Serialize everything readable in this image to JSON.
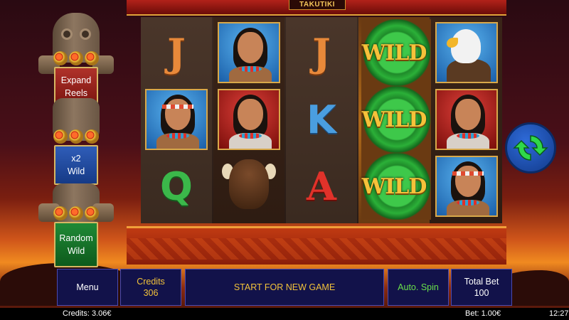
{
  "game": {
    "logo": "TAKUTIKI"
  },
  "features": {
    "expand": [
      "Expand",
      "Reels"
    ],
    "wild": [
      "x2",
      "Wild"
    ],
    "random": [
      "Random",
      "Wild"
    ]
  },
  "reels": {
    "r0": [
      "J",
      "portrait-man",
      "Q"
    ],
    "r1": [
      "portrait-man",
      "portrait-woman",
      "buffalo"
    ],
    "r2": [
      "J",
      "K",
      "A"
    ],
    "r3": [
      "WILD",
      "WILD",
      "WILD"
    ],
    "r4": [
      "eagle",
      "portrait-woman",
      "portrait-man"
    ],
    "wild_text": "WILD"
  },
  "controls": {
    "menu": "Menu",
    "credits_label": "Credits",
    "credits_value": "306",
    "start": "START FOR NEW GAME",
    "auto_spin": "Auto. Spin",
    "total_bet_label": "Total Bet",
    "total_bet_value": "100"
  },
  "status": {
    "credits": "Credits: 3.06€",
    "bet": "Bet: 1.00€",
    "time": "12:27"
  },
  "icons": {
    "spin": "refresh-icon"
  },
  "colors": {
    "gold": "#f2c23a",
    "green": "#6ae04a",
    "panel": "#12124a"
  }
}
